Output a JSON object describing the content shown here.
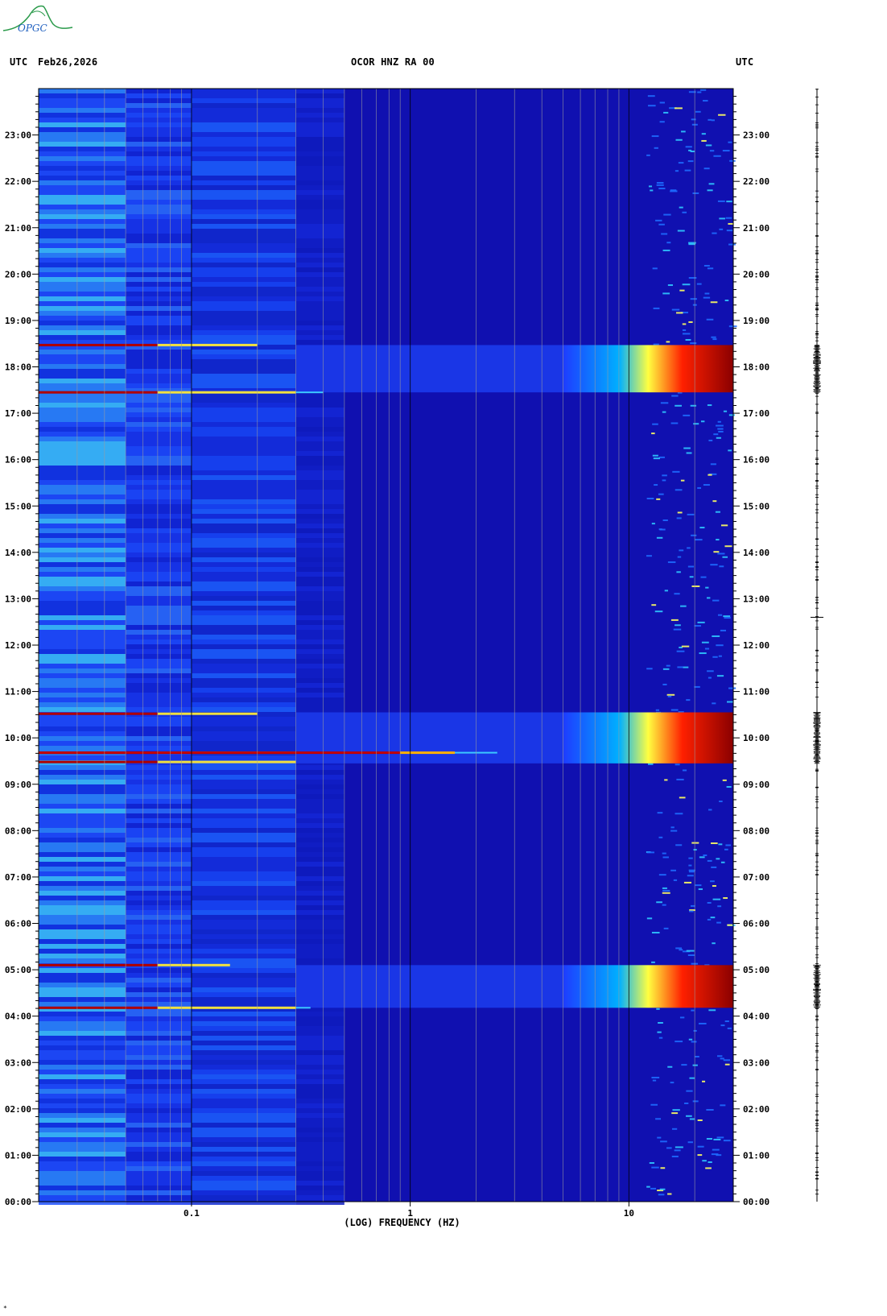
{
  "header": {
    "left_tz": "UTC",
    "date": "Feb26,2026",
    "station": "OCOR HNZ RA 00",
    "right_tz": "UTC"
  },
  "logo": {
    "text": "OPGC",
    "color": "#2a9a4a",
    "text_color": "#1f5fbf"
  },
  "footnote": "*",
  "chart_data": {
    "type": "heatmap",
    "title": "OCOR HNZ RA 00",
    "xlabel": "(LOG) FREQUENCY (HZ)",
    "x_scale": "log",
    "xlim": [
      0.02,
      30
    ],
    "x_tick_labels": [
      {
        "value": 0.1,
        "label": "0.1"
      },
      {
        "value": 1,
        "label": "1"
      },
      {
        "value": 10,
        "label": "10"
      }
    ],
    "ylabel": "UTC",
    "ylim_hours": [
      0,
      24
    ],
    "y_tick_labels": [
      "00:00",
      "01:00",
      "02:00",
      "03:00",
      "04:00",
      "05:00",
      "06:00",
      "07:00",
      "08:00",
      "09:00",
      "10:00",
      "11:00",
      "12:00",
      "13:00",
      "14:00",
      "15:00",
      "16:00",
      "17:00",
      "18:00",
      "19:00",
      "20:00",
      "21:00",
      "22:00",
      "23:00"
    ],
    "colormap": [
      "#00008b",
      "#0000cd",
      "#1e3cff",
      "#00a0ff",
      "#00ffff",
      "#ffff00",
      "#ff8c00",
      "#ff0000",
      "#8b0000"
    ],
    "background_color": "#1010b0",
    "events": [
      {
        "name": "",
        "start_hour": 4.18,
        "end_hour": 5.1,
        "peak_low_freq": 0.07
      },
      {
        "name": "",
        "start_hour": 9.45,
        "end_hour": 10.55,
        "peak_low_freq": 0.07
      },
      {
        "name": "",
        "start_hour": 17.45,
        "end_hour": 18.47,
        "peak_low_freq": 0.07
      }
    ],
    "narrow_lines": [
      {
        "hour": 4.18,
        "fmax": 0.35
      },
      {
        "hour": 5.1,
        "fmax": 0.15
      },
      {
        "hour": 9.48,
        "fmax": 0.3
      },
      {
        "hour": 9.68,
        "fmax": 2.5
      },
      {
        "hour": 10.52,
        "fmax": 0.2
      },
      {
        "hour": 17.45,
        "fmax": 0.4
      },
      {
        "hour": 18.47,
        "fmax": 0.2
      }
    ]
  }
}
